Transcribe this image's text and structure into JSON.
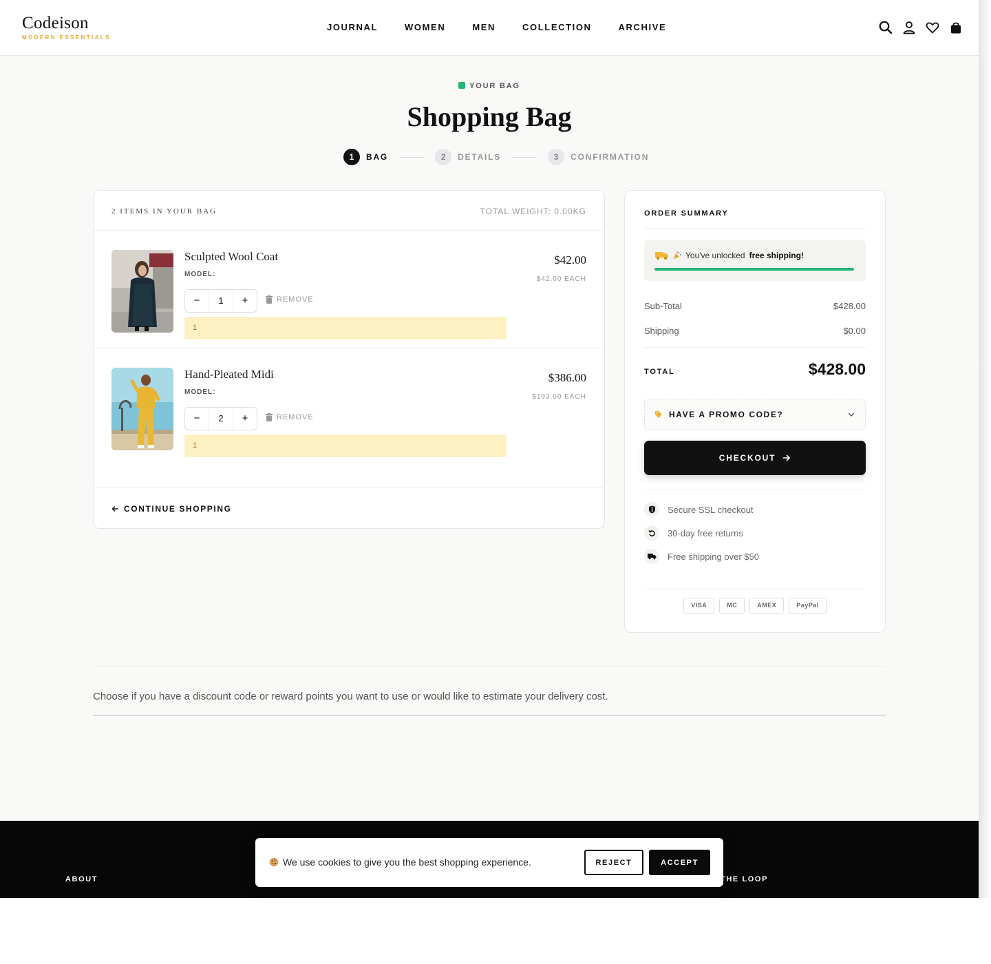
{
  "header": {
    "logo_name": "Codeison",
    "logo_tagline": "MODERN ESSENTIALS",
    "nav": [
      "JOURNAL",
      "WOMEN",
      "MEN",
      "COLLECTION",
      "ARCHIVE"
    ],
    "icons": [
      "search-icon",
      "user-icon",
      "heart-icon",
      "bag-icon"
    ]
  },
  "page": {
    "eyebrow": "YOUR BAG",
    "title": "Shopping Bag",
    "steps": [
      {
        "num": "1",
        "label": "BAG",
        "active": true
      },
      {
        "num": "2",
        "label": "DETAILS",
        "active": false
      },
      {
        "num": "3",
        "label": "CONFIRMATION",
        "active": false
      }
    ]
  },
  "cart": {
    "count_label": "2 ITEMS IN YOUR BAG",
    "weight_label": "TOTAL WEIGHT: 0.00KG",
    "items": [
      {
        "name": "Sculpted Wool Coat",
        "model": "MODEL:",
        "qty": "1",
        "remove": "REMOVE",
        "note": "1",
        "price": "$42.00",
        "each": "$42.00 EACH"
      },
      {
        "name": "Hand-Pleated Midi",
        "model": "MODEL:",
        "qty": "2",
        "remove": "REMOVE",
        "note": "1",
        "price": "$386.00",
        "each": "$193.00 EACH"
      }
    ],
    "continue_label": "CONTINUE SHOPPING"
  },
  "summary": {
    "title": "ORDER SUMMARY",
    "shipping_msg_prefix": "You've unlocked",
    "shipping_msg_bold": "free shipping!",
    "shipping_progress": 1.0,
    "subtotal_label": "Sub-Total",
    "subtotal_value": "$428.00",
    "shipping_label": "Shipping",
    "shipping_value": "$0.00",
    "total_label": "TOTAL",
    "total_value": "$428.00",
    "promo_label": "HAVE A PROMO CODE?",
    "checkout_label": "CHECKOUT",
    "trust": [
      "Secure SSL checkout",
      "30-day free returns",
      "Free shipping over $50"
    ],
    "payments": [
      "VISA",
      "MC",
      "AMEX",
      "PayPal"
    ]
  },
  "discount_text": "Choose if you have a discount code or reward points you want to use or would like to estimate your delivery cost.",
  "footer": {
    "about": "ABOUT",
    "loop": "THE LOOP"
  },
  "cookie": {
    "text": "We use cookies to give you the best shopping experience.",
    "reject": "REJECT",
    "accept": "ACCEPT"
  },
  "colors": {
    "accent_green": "#22b573",
    "logo_gold": "#e4a72a",
    "note_bg": "#fdf1c4",
    "dark": "#111111"
  }
}
